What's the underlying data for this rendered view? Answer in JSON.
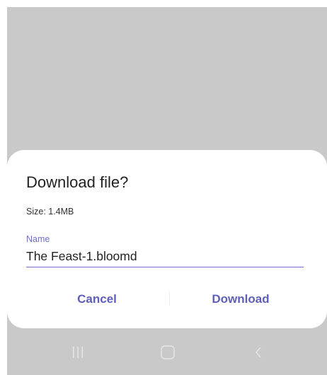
{
  "dialog": {
    "title": "Download file?",
    "size_text": "Size: 1.4MB",
    "name_label": "Name",
    "name_value": "The Feast-1.bloomd",
    "cancel_label": "Cancel",
    "download_label": "Download"
  },
  "navbar": {
    "items": [
      "recent-apps-icon",
      "home-icon",
      "back-icon"
    ]
  },
  "colors": {
    "accent": "#5d5fb8",
    "scrim": "#c9c9c9",
    "dialog_bg": "#ffffff"
  }
}
